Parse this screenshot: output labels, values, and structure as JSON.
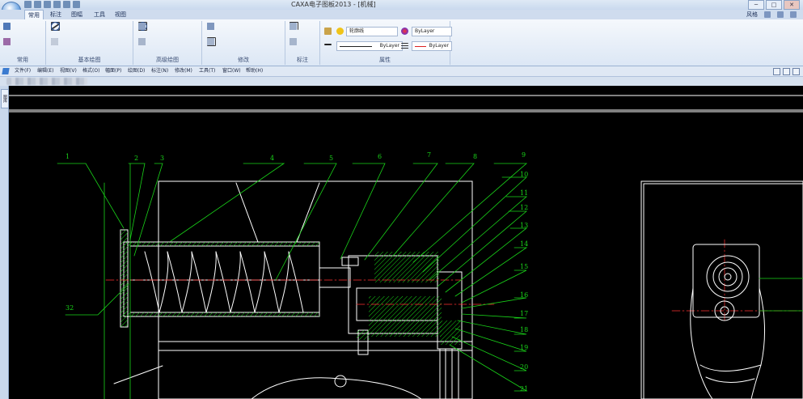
{
  "window": {
    "title": "CAXA电子图板2013 - [机械]",
    "controls": [
      "─",
      "□",
      "✕"
    ]
  },
  "ribbon_tabs": [
    {
      "label": "常用",
      "active": true
    },
    {
      "label": "标注",
      "active": false
    },
    {
      "label": "图幅",
      "active": false
    },
    {
      "label": "工具",
      "active": false
    },
    {
      "label": "视图",
      "active": false
    }
  ],
  "ribbon_right": {
    "style_label": "风格"
  },
  "ribbon_groups": [
    {
      "label": "常用"
    },
    {
      "label": "基本绘图"
    },
    {
      "label": "高级绘图"
    },
    {
      "label": "修改"
    },
    {
      "label": "标注"
    },
    {
      "label": "属性"
    }
  ],
  "properties": {
    "layer": "轮廓线",
    "color1": "ByLayer",
    "linetype": "ByLayer",
    "linewidth": "ByLayer"
  },
  "menu": [
    "文件(F)",
    "编辑(E)",
    "视图(V)",
    "格式(O)",
    "幅面(P)",
    "绘图(D)",
    "标注(N)",
    "修改(M)",
    "工具(T)",
    "窗口(W)",
    "帮助(H)"
  ],
  "side_panel": {
    "tab": "图库"
  },
  "drawing": {
    "balloons": [
      "1",
      "2",
      "3",
      "4",
      "5",
      "6",
      "7",
      "8",
      "9",
      "10",
      "11",
      "12",
      "13",
      "14",
      "15",
      "16",
      "17",
      "18",
      "19",
      "20",
      "21",
      "32"
    ]
  },
  "colors": {
    "canvas": "#000000",
    "leader": "#19d319",
    "outline": "#ffffff",
    "centerline": "#ff3030",
    "hatch": "#19d319"
  }
}
